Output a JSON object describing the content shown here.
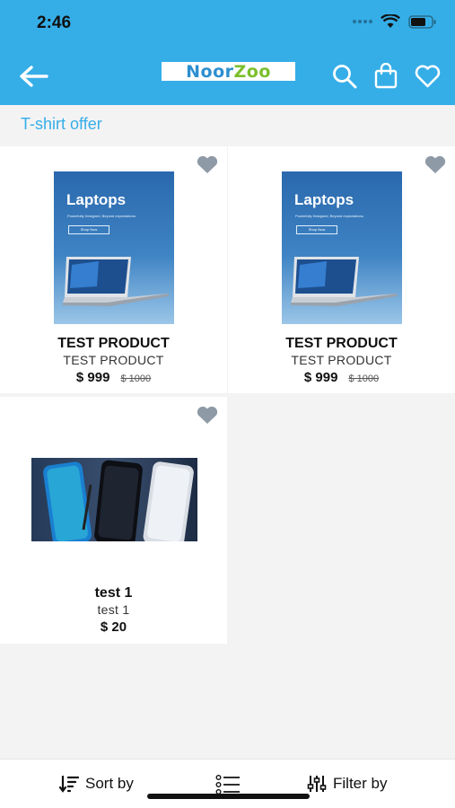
{
  "status_bar": {
    "time": "2:46"
  },
  "header": {
    "logo_noor": "Noor",
    "logo_zoo": "Zoo",
    "icons": [
      "back-arrow-icon",
      "search-icon",
      "shopping-bag-icon",
      "heart-icon"
    ]
  },
  "section": {
    "title": "T-shirt offer"
  },
  "products": [
    {
      "name": "TEST PRODUCT",
      "subtitle": "TEST PRODUCT",
      "price": "$ 999",
      "old_price": "$ 1000",
      "image": {
        "heading": "Laptops",
        "tagline": "Powerfully Designed, Beyond expectations",
        "button": "Shop Now"
      }
    },
    {
      "name": "TEST PRODUCT",
      "subtitle": "TEST PRODUCT",
      "price": "$ 999",
      "old_price": "$ 1000",
      "image": {
        "heading": "Laptops",
        "tagline": "Powerfully Designed, Beyond expectations",
        "button": "Shop Now"
      }
    },
    {
      "name": "test 1",
      "subtitle": "test 1",
      "price": "$ 20"
    }
  ],
  "bottom_bar": {
    "sort_label": "Sort by",
    "filter_label": "Filter by"
  },
  "colors": {
    "accent": "#35aee8",
    "background": "#f4f3f4",
    "heart": "#8e9aa6"
  }
}
